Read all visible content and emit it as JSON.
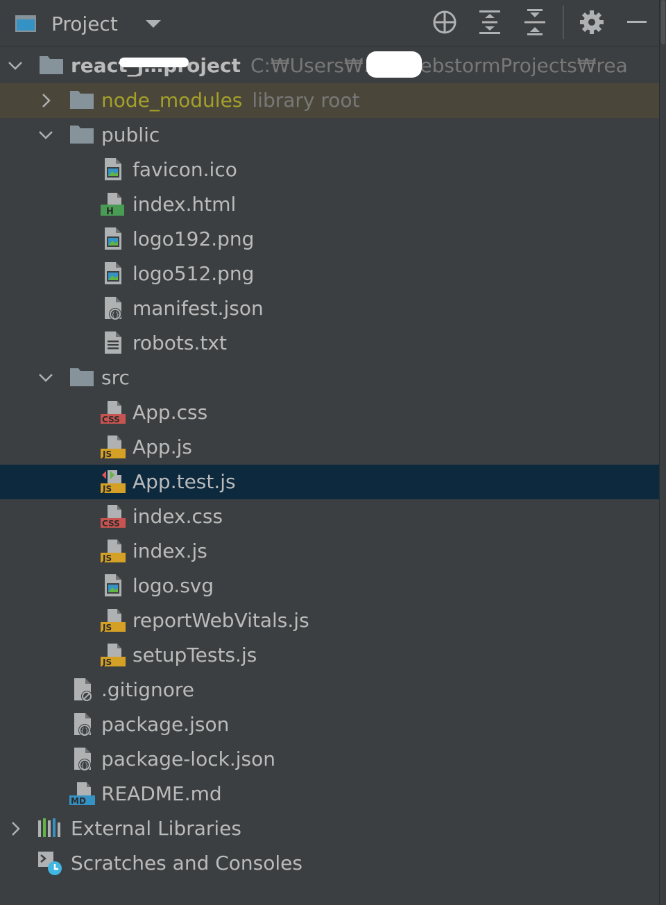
{
  "toolbar": {
    "title": "Project",
    "icons": [
      "window-icon",
      "dropdown-caret-icon",
      "locate-icon",
      "expand-all-icon",
      "collapse-all-icon",
      "gear-icon",
      "minimize-icon"
    ]
  },
  "tree": {
    "root": {
      "name": "react_j…project",
      "path": "C:₩Users₩…₩WebstormProjects₩rea"
    },
    "node_modules": {
      "name": "node_modules",
      "suffix": "library root"
    },
    "public": {
      "name": "public",
      "files": [
        "favicon.ico",
        "index.html",
        "logo192.png",
        "logo512.png",
        "manifest.json",
        "robots.txt"
      ]
    },
    "src": {
      "name": "src",
      "files": [
        "App.css",
        "App.js",
        "App.test.js",
        "index.css",
        "index.js",
        "logo.svg",
        "reportWebVitals.js",
        "setupTests.js"
      ]
    },
    "root_files": [
      ".gitignore",
      "package.json",
      "package-lock.json",
      "README.md"
    ],
    "external": "External Libraries",
    "scratches": "Scratches and Consoles"
  },
  "badges": {
    "css": "CSS",
    "js": "JS",
    "html": "H",
    "md": "MD"
  },
  "colors": {
    "background": "#3c3f41",
    "selected_row": "#0d293e",
    "excluded_row": "#4a473a",
    "text": "#bbbbbb",
    "path_text": "#787878",
    "library_root": "#a5a02a",
    "folder": "#87939a",
    "js_badge": "#d4a026",
    "css_badge": "#c75450",
    "html_badge": "#499c54",
    "md_badge": "#3592c4"
  }
}
